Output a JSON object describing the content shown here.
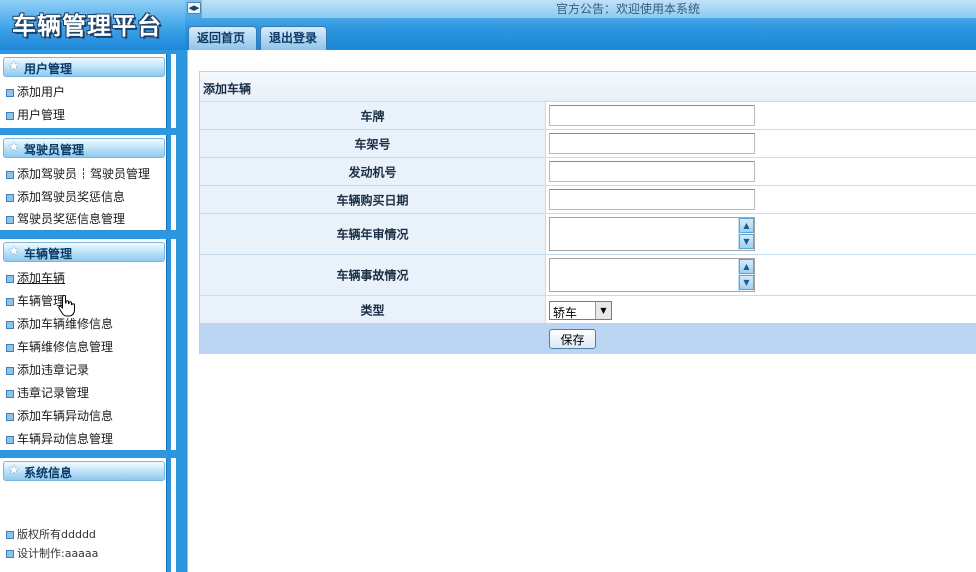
{
  "header": {
    "app_title": "车辆管理平台",
    "notice": "官方公告：欢迎使用本系统",
    "tabs": [
      {
        "label": "返回首页"
      },
      {
        "label": "退出登录"
      }
    ]
  },
  "sidebar": {
    "user_panel": {
      "title": "用户管理",
      "items": [
        {
          "label": "添加用户"
        },
        {
          "label": "用户管理"
        }
      ]
    },
    "driver_panel": {
      "title": "驾驶员管理",
      "items": [
        {
          "label": "添加驾驶员"
        },
        {
          "label": "驾驶员管理"
        },
        {
          "label": "添加驾驶员奖惩信息"
        },
        {
          "label": "驾驶员奖惩信息管理"
        }
      ]
    },
    "vehicle_panel": {
      "title": "车辆管理",
      "items": [
        {
          "label": "添加车辆"
        },
        {
          "label": "车辆管理"
        },
        {
          "label": "添加车辆维修信息"
        },
        {
          "label": "车辆维修信息管理"
        },
        {
          "label": "添加违章记录"
        },
        {
          "label": "违章记录管理"
        },
        {
          "label": "添加车辆异动信息"
        },
        {
          "label": "车辆异动信息管理"
        }
      ]
    },
    "system_panel": {
      "title": "系统信息",
      "copyright": "版权所有ddddd",
      "designer": "设计制作:aaaaa"
    }
  },
  "form": {
    "title": "添加车辆",
    "fields": [
      {
        "label": "车牌",
        "value": ""
      },
      {
        "label": "车架号",
        "value": ""
      },
      {
        "label": "发动机号",
        "value": ""
      },
      {
        "label": "车辆购买日期",
        "value": ""
      },
      {
        "label": "车辆年审情况",
        "value": ""
      },
      {
        "label": "车辆事故情况",
        "value": ""
      },
      {
        "label": "类型",
        "value": "轿车"
      }
    ],
    "save_label": "保存"
  },
  "colors": {
    "header_blue": "#2f97e0",
    "sidebar_blue": "#2c96df",
    "label_cell_bg": "#e9f1fa",
    "button_row_bg": "#bcd5f3"
  },
  "icons": {
    "panel_header": "star-icon",
    "menu_bullet": "square-bullet-icon",
    "collapse_toggle": "left-right-arrows-icon",
    "cursor": "hand-pointer-icon"
  }
}
